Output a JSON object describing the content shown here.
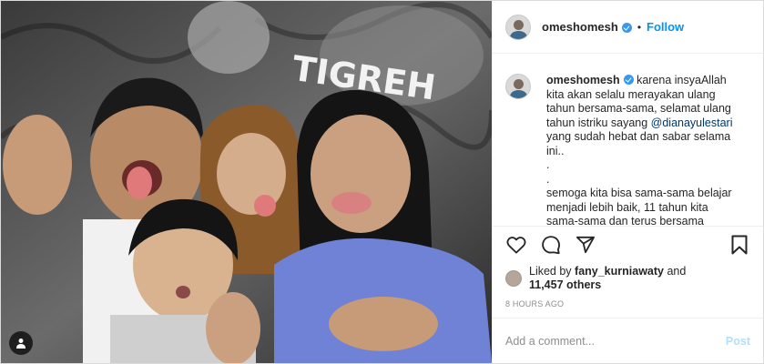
{
  "header": {
    "username": "omeshomesh",
    "separator": "•",
    "follow_label": "Follow"
  },
  "caption": {
    "username": "omeshomesh",
    "text_before_mention": "karena insyaAllah kita akan selalu merayakan ulang tahun bersama-sama, selamat ulang tahun istriku sayang ",
    "mention": "@dianayulestari",
    "text_after_mention": "yang sudah hebat dan sabar selama ini..",
    "line_dot_1": ".",
    "line_dot_2": ".",
    "text_more": "semoga kita bisa sama-sama belajar menjadi lebih baik, 11 tahun kita sama-sama dan terus bersama selamanya"
  },
  "likes": {
    "prefix": "Liked by ",
    "liker": "fany_kurniawaty",
    "joiner": " and",
    "others": "11,457 others"
  },
  "timestamp": "8 HOURS AGO",
  "comment_box": {
    "placeholder": "Add a comment...",
    "post_label": "Post"
  },
  "photo": {
    "background_text": "TIGREH"
  },
  "icons": {
    "like": "heart-icon",
    "comment": "comment-icon",
    "share": "share-icon",
    "save": "bookmark-icon",
    "tags": "user-tag-icon"
  },
  "colors": {
    "accent": "#0095f6",
    "verified": "#3897f0",
    "post_disabled": "#b2dffc",
    "muted": "#8e8e8e"
  }
}
